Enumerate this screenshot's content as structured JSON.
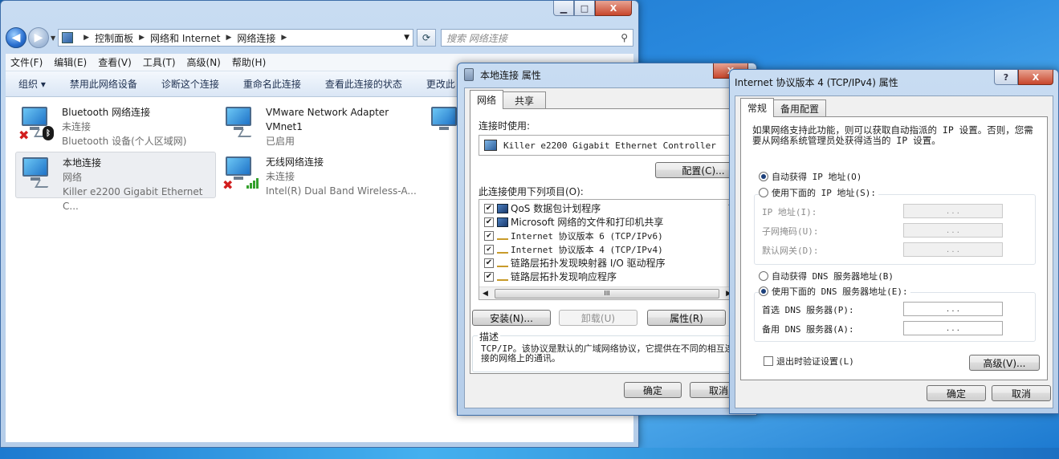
{
  "explorer": {
    "buttons": {
      "minimize": "▁",
      "maximize": "□",
      "close": "X"
    },
    "breadcrumb": [
      "控制面板",
      "网络和 Internet",
      "网络连接"
    ],
    "search_placeholder": "搜索 网络连接",
    "menu": [
      "文件(F)",
      "编辑(E)",
      "查看(V)",
      "工具(T)",
      "高级(N)",
      "帮助(H)"
    ],
    "commands": [
      "组织 ▾",
      "禁用此网络设备",
      "诊断这个连接",
      "重命名此连接",
      "查看此连接的状态",
      "更改此"
    ],
    "connections": [
      {
        "name": "Bluetooth 网络连接",
        "status": "未连接",
        "device": "Bluetooth 设备(个人区域网)"
      },
      {
        "name": "VMware Network Adapter",
        "status": "VMnet1",
        "device": "已启用"
      },
      {
        "name": "本地连接",
        "status": "网络",
        "device": "Killer e2200 Gigabit Ethernet C..."
      },
      {
        "name": "无线网络连接",
        "status": "未连接",
        "device": "Intel(R) Dual Band Wireless-A..."
      }
    ]
  },
  "props": {
    "title": "本地连接 属性",
    "close": "X",
    "tabs": [
      "网络",
      "共享"
    ],
    "connect_using_label": "连接时使用:",
    "adapter": "Killer e2200 Gigabit Ethernet Controller",
    "configure": "配置(C)...",
    "items_label": "此连接使用下列项目(O):",
    "items": [
      {
        "label": "QoS 数据包计划程序",
        "checked": "✔"
      },
      {
        "label": "Microsoft 网络的文件和打印机共享",
        "checked": "✔"
      },
      {
        "label": "Internet 协议版本 6 (TCP/IPv6)",
        "checked": "✔"
      },
      {
        "label": "Internet 协议版本 4 (TCP/IPv4)",
        "checked": "✔"
      },
      {
        "label": "链路层拓扑发现映射器 I/O 驱动程序",
        "checked": "✔"
      },
      {
        "label": "链路层拓扑发现响应程序",
        "checked": "✔"
      }
    ],
    "scroll_thumb": "III",
    "install": "安装(N)...",
    "uninstall": "卸载(U)",
    "properties": "属性(R)",
    "desc_label": "描述",
    "desc_text": "TCP/IP。该协议是默认的广域网络协议，它提供在不同的相互连接的网络上的通讯。",
    "ok": "确定",
    "cancel": "取消"
  },
  "ipv4": {
    "title": "Internet 协议版本 4 (TCP/IPv4) 属性",
    "help": "?",
    "close": "X",
    "tabs": [
      "常规",
      "备用配置"
    ],
    "intro": "如果网络支持此功能，则可以获取自动指派的 IP 设置。否则，您需要从网络系统管理员处获得适当的 IP 设置。",
    "auto_ip": "自动获得 IP 地址(O)",
    "manual_ip": "使用下面的 IP 地址(S):",
    "ip_label": "IP 地址(I):",
    "mask_label": "子网掩码(U):",
    "gateway_label": "默认网关(D):",
    "auto_dns": "自动获得 DNS 服务器地址(B)",
    "manual_dns": "使用下面的 DNS 服务器地址(E):",
    "pref_dns": "首选 DNS 服务器(P):",
    "alt_dns": "备用 DNS 服务器(A):",
    "validate": "退出时验证设置(L)",
    "advanced": "高级(V)...",
    "ok": "确定",
    "cancel": "取消",
    "dots": ".   .   ."
  }
}
